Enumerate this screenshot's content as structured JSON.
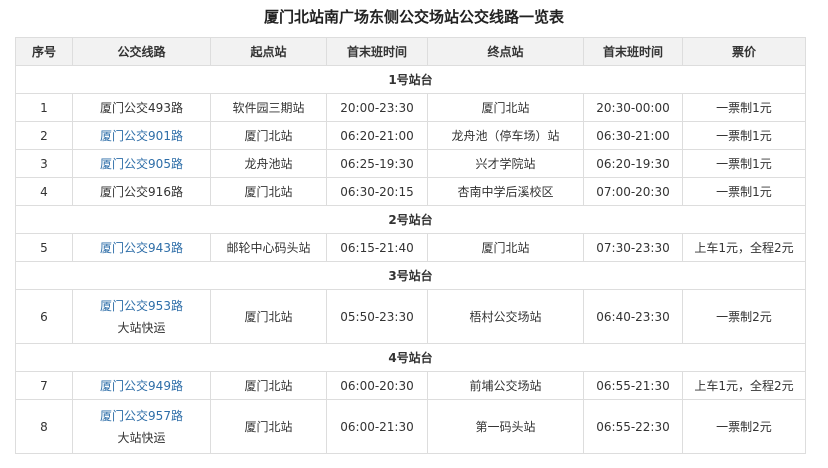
{
  "title": "厦门北站南广场东侧公交场站公交线路一览表",
  "headers": [
    "序号",
    "公交线路",
    "起点站",
    "首末班时间",
    "终点站",
    "首末班时间",
    "票价"
  ],
  "groups": [
    {
      "name": "1号站台",
      "rows": [
        {
          "no": "1",
          "route": "厦门公交493路",
          "route_link": false,
          "route_sub": "",
          "start": "软件园三期站",
          "start_time": "20:00-23:30",
          "end": "厦门北站",
          "end_time": "20:30-00:00",
          "fare": "一票制1元"
        },
        {
          "no": "2",
          "route": "厦门公交901路",
          "route_link": true,
          "route_sub": "",
          "start": "厦门北站",
          "start_time": "06:20-21:00",
          "end": "龙舟池（停车场）站",
          "end_time": "06:30-21:00",
          "fare": "一票制1元"
        },
        {
          "no": "3",
          "route": "厦门公交905路",
          "route_link": true,
          "route_sub": "",
          "start": "龙舟池站",
          "start_time": "06:25-19:30",
          "end": "兴才学院站",
          "end_time": "06:20-19:30",
          "fare": "一票制1元"
        },
        {
          "no": "4",
          "route": "厦门公交916路",
          "route_link": false,
          "route_sub": "",
          "start": "厦门北站",
          "start_time": "06:30-20:15",
          "end": "杏南中学后溪校区",
          "end_time": "07:00-20:30",
          "fare": "一票制1元"
        }
      ]
    },
    {
      "name": "2号站台",
      "rows": [
        {
          "no": "5",
          "route": "厦门公交943路",
          "route_link": true,
          "route_sub": "",
          "start": "邮轮中心码头站",
          "start_time": "06:15-21:40",
          "end": "厦门北站",
          "end_time": "07:30-23:30",
          "fare": "上车1元，全程2元"
        }
      ]
    },
    {
      "name": "3号站台",
      "rows": [
        {
          "no": "6",
          "route": "厦门公交953路",
          "route_link": true,
          "route_sub": "大站快运",
          "start": "厦门北站",
          "start_time": "05:50-23:30",
          "end": "梧村公交场站",
          "end_time": "06:40-23:30",
          "fare": "一票制2元"
        }
      ]
    },
    {
      "name": "4号站台",
      "rows": [
        {
          "no": "7",
          "route": "厦门公交949路",
          "route_link": true,
          "route_sub": "",
          "start": "厦门北站",
          "start_time": "06:00-20:30",
          "end": "前埔公交场站",
          "end_time": "06:55-21:30",
          "fare": "上车1元，全程2元"
        },
        {
          "no": "8",
          "route": "厦门公交957路",
          "route_link": true,
          "route_sub": "大站快运",
          "start": "厦门北站",
          "start_time": "06:00-21:30",
          "end": "第一码头站",
          "end_time": "06:55-22:30",
          "fare": "一票制2元"
        }
      ]
    }
  ],
  "colors": {
    "link": "#2e6ea8",
    "header_bg": "#f2f2f2",
    "border": "#dddddd"
  }
}
